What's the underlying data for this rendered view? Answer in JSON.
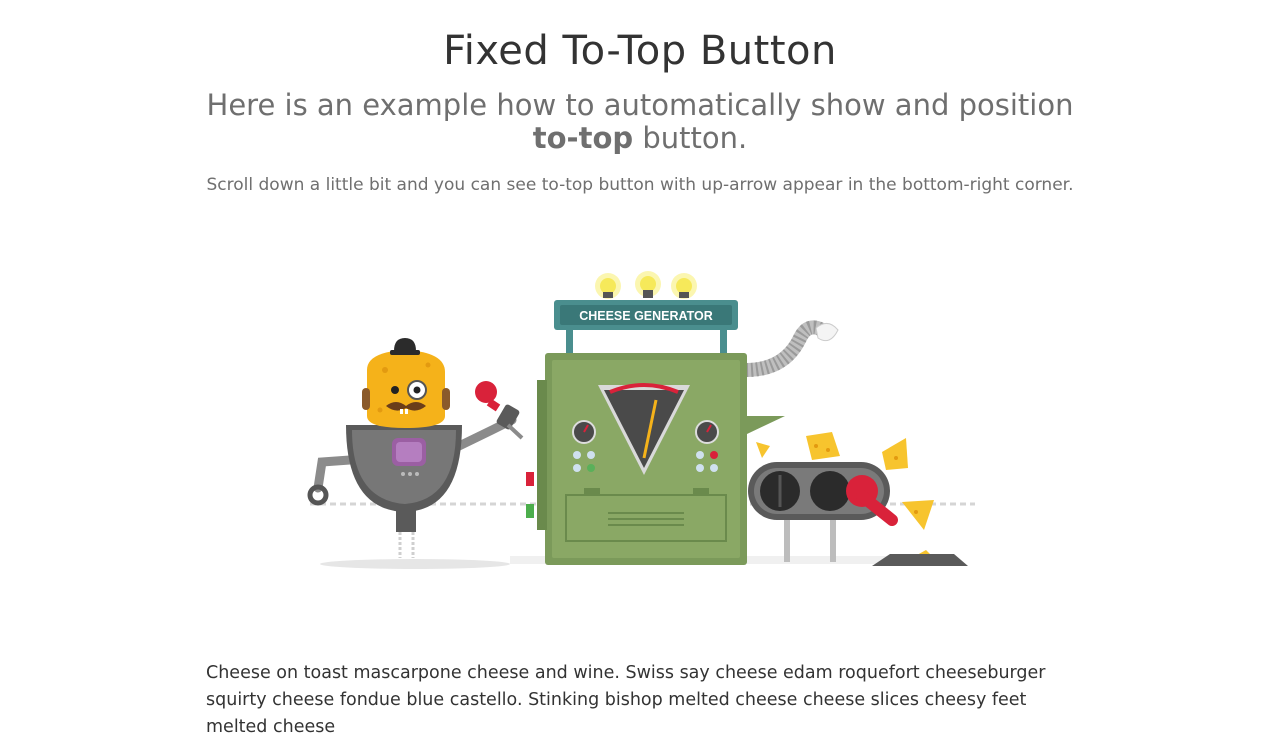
{
  "page": {
    "title": "Fixed To-Top Button",
    "subtitle_before": "Here is an example how to automatically show and position ",
    "subtitle_bold": "to-top",
    "subtitle_after": " button.",
    "lead": "Scroll down a little bit and you can see to-top button with up-arrow appear in the bottom-right corner.",
    "body": "Cheese on toast mascarpone cheese and wine. Swiss say cheese edam roquefort cheeseburger squirty cheese fondue blue castello. Stinking bishop melted cheese cheese slices cheesy feet melted cheese"
  },
  "illustration": {
    "sign_label": "CHEESE GENERATOR",
    "icons": [
      "robot-icon",
      "cheese-generator-machine-icon",
      "conveyor-belt-icon",
      "cheese-wedge-icon",
      "light-bulb-icon"
    ],
    "colors": {
      "machine_green": "#7b9a5a",
      "robot_head": "#f5b21a",
      "robot_body": "#5a5a5a",
      "cheese": "#f7c42e",
      "sign_teal": "#4a8e8e",
      "lever_red": "#d9223a"
    }
  }
}
